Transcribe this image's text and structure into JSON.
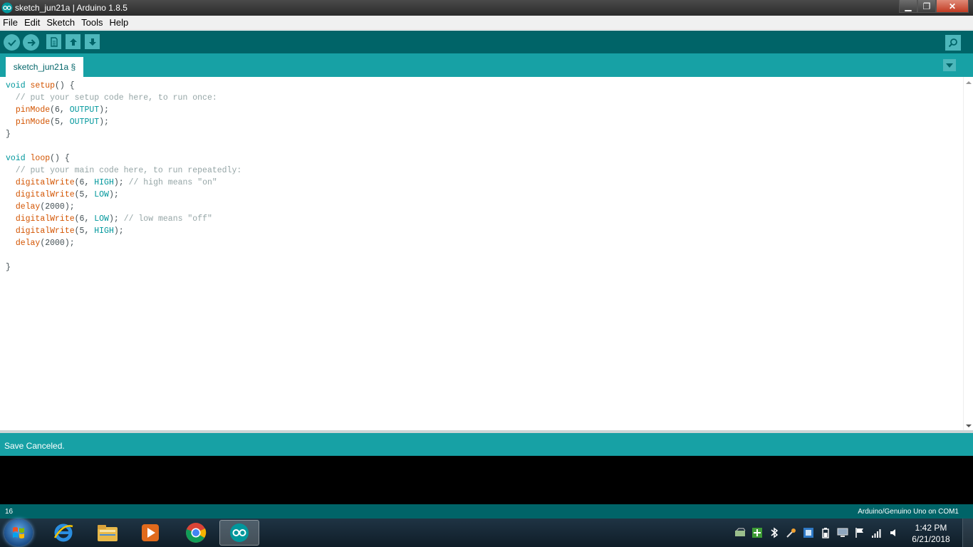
{
  "window": {
    "title": "sketch_jun21a | Arduino 1.8.5",
    "minimize_label": "▁",
    "maximize_label": "❐",
    "close_label": "✕"
  },
  "menu": {
    "items": [
      "File",
      "Edit",
      "Sketch",
      "Tools",
      "Help"
    ]
  },
  "toolbar": {
    "buttons": [
      "verify-icon",
      "upload-icon",
      "new-icon",
      "open-icon",
      "save-icon"
    ],
    "serial_monitor": "serial-monitor-icon"
  },
  "tabs": {
    "active_tab": "sketch_jun21a §"
  },
  "editor": {
    "lines": [
      [
        {
          "t": "void",
          "c": "kw-type"
        },
        {
          "t": " "
        },
        {
          "t": "setup",
          "c": "kw-func"
        },
        {
          "t": "() {"
        }
      ],
      [
        {
          "t": "  // put your setup code here, to run once:",
          "c": "cmt"
        }
      ],
      [
        {
          "t": "  "
        },
        {
          "t": "pinMode",
          "c": "kw-func"
        },
        {
          "t": "(6, "
        },
        {
          "t": "OUTPUT",
          "c": "kw-const"
        },
        {
          "t": ");"
        }
      ],
      [
        {
          "t": "  "
        },
        {
          "t": "pinMode",
          "c": "kw-func"
        },
        {
          "t": "(5, "
        },
        {
          "t": "OUTPUT",
          "c": "kw-const"
        },
        {
          "t": ");"
        }
      ],
      [
        {
          "t": "}"
        }
      ],
      [
        {
          "t": ""
        }
      ],
      [
        {
          "t": "void",
          "c": "kw-type"
        },
        {
          "t": " "
        },
        {
          "t": "loop",
          "c": "kw-func"
        },
        {
          "t": "() {"
        }
      ],
      [
        {
          "t": "  // put your main code here, to run repeatedly:",
          "c": "cmt"
        }
      ],
      [
        {
          "t": "  "
        },
        {
          "t": "digitalWrite",
          "c": "kw-func"
        },
        {
          "t": "(6, "
        },
        {
          "t": "HIGH",
          "c": "kw-const"
        },
        {
          "t": "); "
        },
        {
          "t": "// high means \"on\"",
          "c": "cmt"
        }
      ],
      [
        {
          "t": "  "
        },
        {
          "t": "digitalWrite",
          "c": "kw-func"
        },
        {
          "t": "(5, "
        },
        {
          "t": "LOW",
          "c": "kw-const"
        },
        {
          "t": ");"
        }
      ],
      [
        {
          "t": "  "
        },
        {
          "t": "delay",
          "c": "kw-func"
        },
        {
          "t": "(2000);"
        }
      ],
      [
        {
          "t": "  "
        },
        {
          "t": "digitalWrite",
          "c": "kw-func"
        },
        {
          "t": "(6, "
        },
        {
          "t": "LOW",
          "c": "kw-const"
        },
        {
          "t": "); "
        },
        {
          "t": "// low means \"off\"",
          "c": "cmt"
        }
      ],
      [
        {
          "t": "  "
        },
        {
          "t": "digitalWrite",
          "c": "kw-func"
        },
        {
          "t": "(5, "
        },
        {
          "t": "HIGH",
          "c": "kw-const"
        },
        {
          "t": ");"
        }
      ],
      [
        {
          "t": "  "
        },
        {
          "t": "delay",
          "c": "kw-func"
        },
        {
          "t": "(2000);"
        }
      ],
      [
        {
          "t": ""
        }
      ],
      [
        {
          "t": "}"
        }
      ]
    ]
  },
  "status": {
    "message": "Save Canceled."
  },
  "footer": {
    "line_number": "16",
    "board": "Arduino/Genuino Uno on COM1"
  },
  "taskbar": {
    "apps": [
      "internet-explorer-icon",
      "file-explorer-icon",
      "media-player-icon",
      "chrome-icon",
      "arduino-icon"
    ],
    "clock_time": "1:42 PM",
    "clock_date": "6/21/2018"
  },
  "colors": {
    "toolbar_dark": "#006468",
    "toolbar_light": "#17a1a5",
    "button": "#4db7bb"
  }
}
